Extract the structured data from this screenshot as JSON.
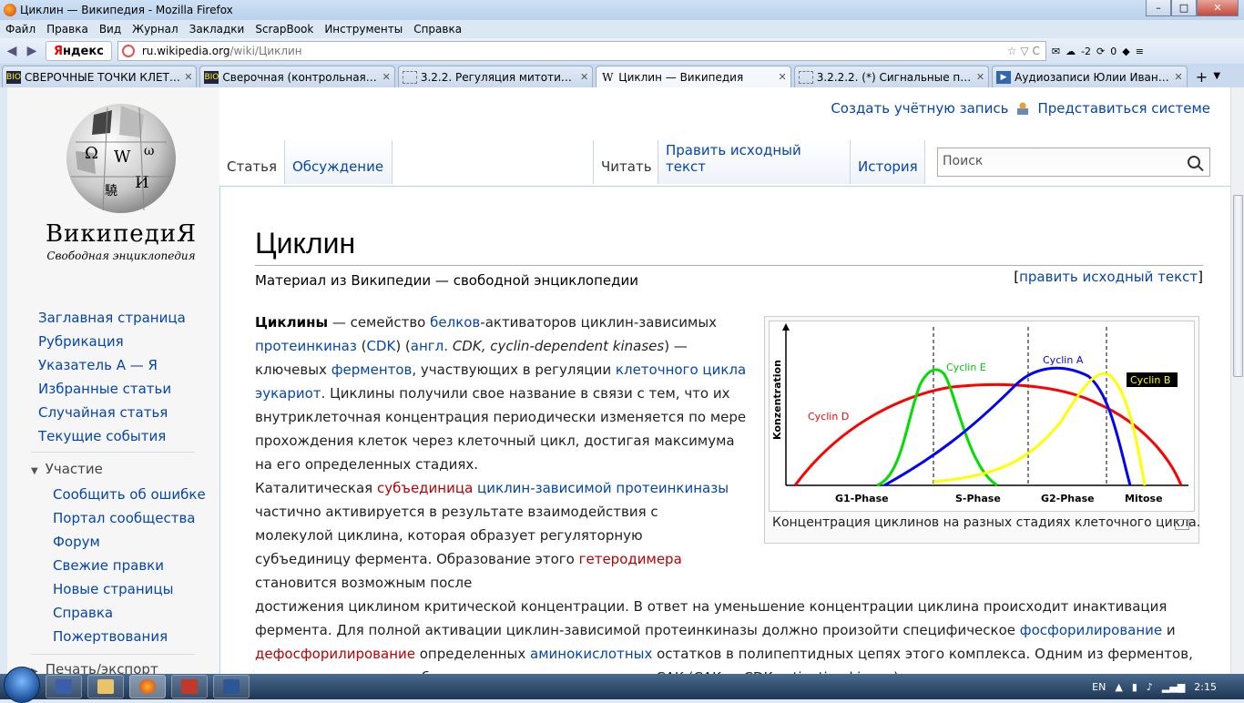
{
  "window": {
    "title": "Циклин — Википедия - Mozilla Firefox"
  },
  "menu": [
    "Файл",
    "Правка",
    "Вид",
    "Журнал",
    "Закладки",
    "ScrapBook",
    "Инструменты",
    "Справка"
  ],
  "navbar": {
    "yandex_y": "Я",
    "yandex_rest": "ндекс",
    "url_host": "ru.wikipedia.org",
    "url_path": "/wiki/Циклин",
    "mail_count": "-2",
    "badge_count": "0"
  },
  "tabs": [
    {
      "label": "СВЕРОЧНЫЕ ТОЧКИ КЛЕТОЧ...",
      "fav": "bio"
    },
    {
      "label": "Сверочная (контрольная) точ...",
      "fav": "bio"
    },
    {
      "label": "3.2.2. Регуляция митотическог...",
      "fav": "doc"
    },
    {
      "label": "Циклин — Википедия",
      "fav": "W"
    },
    {
      "label": "3.2.2.2. (*) Сигнальные пути, и...",
      "fav": "doc"
    },
    {
      "label": "Аудиозаписи Юлии Ивановой...",
      "fav": "play"
    }
  ],
  "logo": {
    "title": "ВикипедиЯ",
    "subtitle": "Свободная энциклопедия"
  },
  "nav_main": [
    "Заглавная страница",
    "Рубрикация",
    "Указатель А — Я",
    "Избранные статьи",
    "Случайная статья",
    "Текущие события"
  ],
  "portal_heading": "Участие",
  "nav_portal": [
    "Сообщить об ошибке",
    "Портал сообщества",
    "Форум",
    "Свежие правки",
    "Новые страницы",
    "Справка",
    "Пожертвования"
  ],
  "print_heading": "Печать/экспорт",
  "personal": {
    "create": "Создать учётную запись",
    "login": "Представиться системе"
  },
  "tabs_left": {
    "article": "Статья",
    "talk": "Обсуждение"
  },
  "tabs_right": {
    "read": "Читать",
    "edit": "Править исходный текст",
    "history": "История"
  },
  "search": {
    "placeholder": "Поиск"
  },
  "article": {
    "title": "Циклин",
    "sitesub": "Материал из Википедии — свободной энциклопедии",
    "edit_open": "[",
    "edit_link": "править исходный текст",
    "edit_close": "]",
    "caption": "Концентрация циклинов на разных стадиях клеточного цикла."
  },
  "chart_data": {
    "type": "line",
    "ylabel": "Konzentration",
    "phases": [
      "G1-Phase",
      "S-Phase",
      "G2-Phase",
      "Mitose"
    ],
    "series": [
      {
        "name": "Cyclin D",
        "color": "#ff0000"
      },
      {
        "name": "Cyclin E",
        "color": "#00dd00"
      },
      {
        "name": "Cyclin A",
        "color": "#0000ff"
      },
      {
        "name": "Cyclin B",
        "color": "#ffff00"
      }
    ]
  },
  "taskbar": {
    "lang": "EN",
    "time": "2:15"
  }
}
